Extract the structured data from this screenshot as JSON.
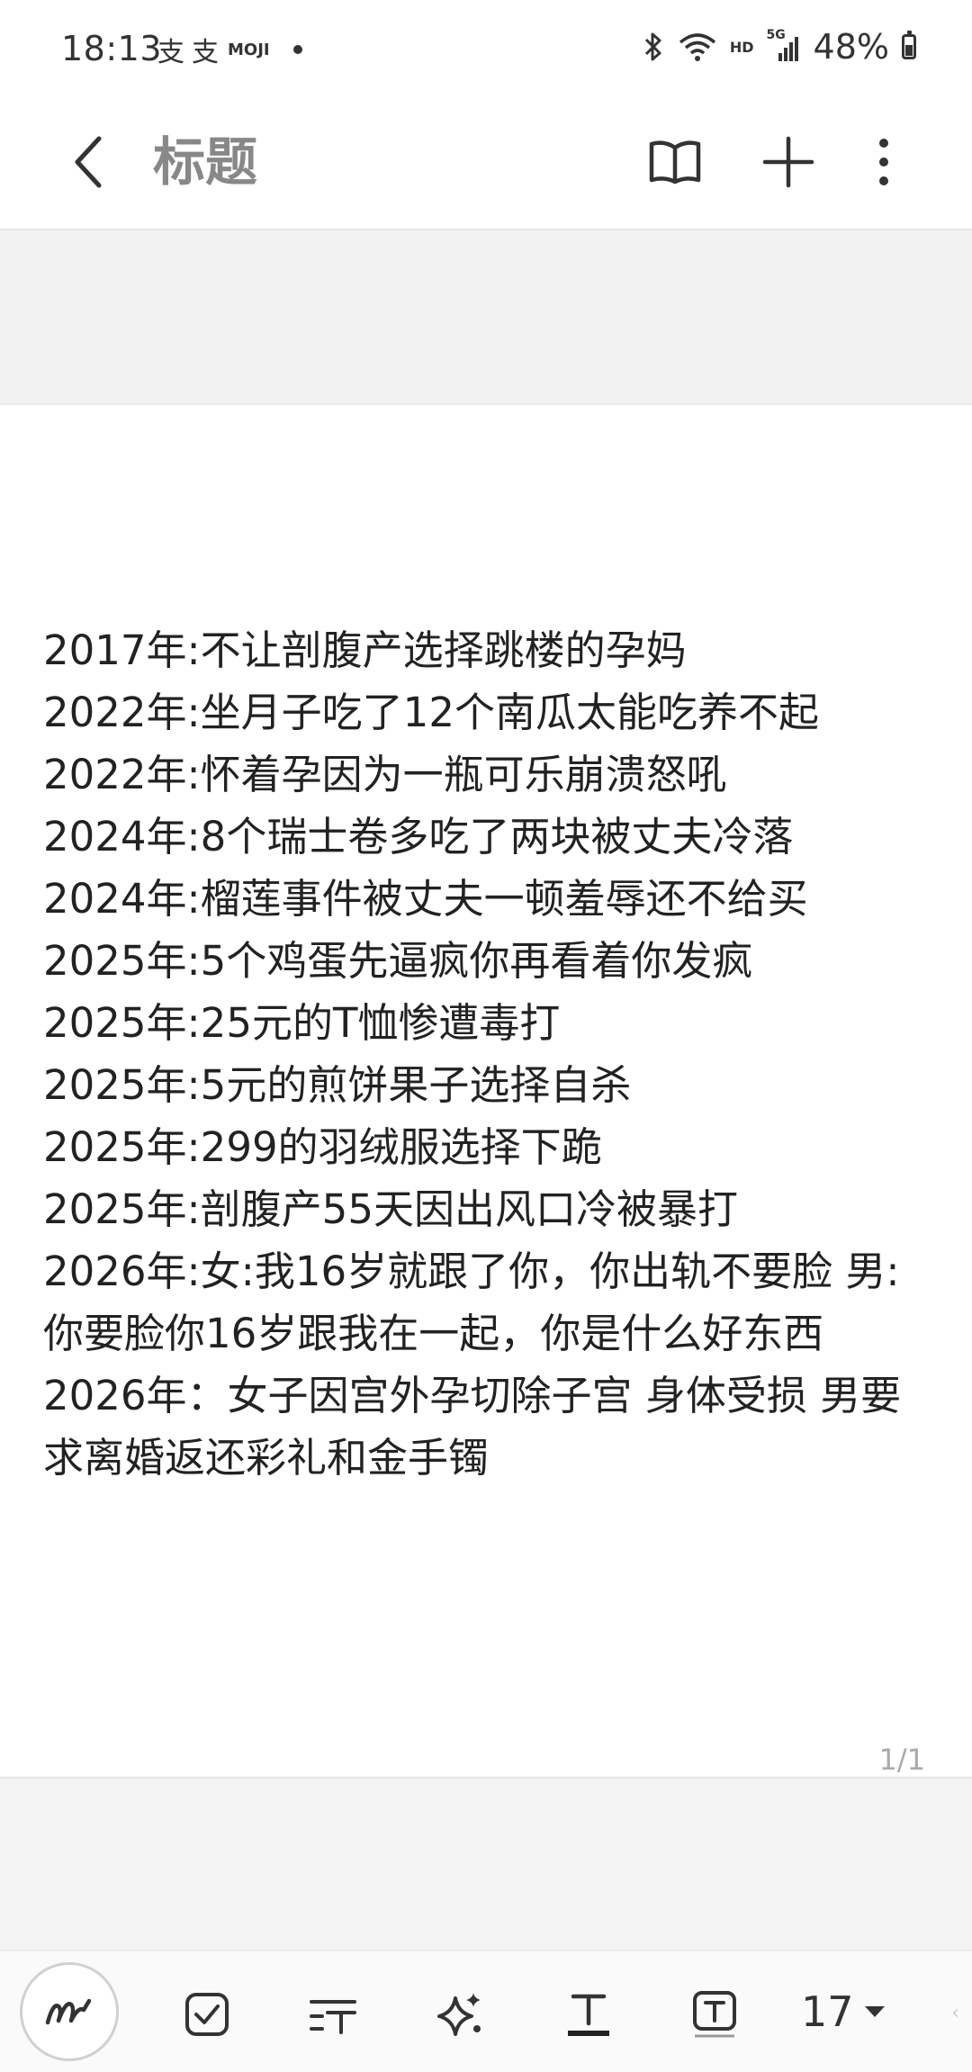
{
  "status_bar": {
    "time": "18:13",
    "app_glyph_1": "支",
    "app_glyph_2": "支",
    "moji": "MOJI",
    "hd": "HD",
    "network": "5G",
    "battery_percent": "48%"
  },
  "header": {
    "title": "标题"
  },
  "note": {
    "lines": [
      "2017年:不让剖腹产选择跳楼的孕妈",
      "2022年:坐月子吃了12个南瓜太能吃养不起",
      "2022年:怀着孕因为一瓶可乐崩溃怒吼",
      "2024年:8个瑞士卷多吃了两块被丈夫冷落",
      "2024年:榴莲事件被丈夫一顿羞辱还不给买",
      "2025年:5个鸡蛋先逼疯你再看着你发疯",
      "2025年:25元的T恤惨遭毒打",
      "2025年:5元的煎饼果子选择自杀",
      "2025年:299的羽绒服选择下跪",
      "2025年:剖腹产55天因出风口冷被暴打",
      "2026年:女:我16岁就跟了你，你出轨不要脸 男:你要脸你16岁跟我在一起，你是什么好东西",
      "2026年：女子因宫外孕切除子宫 身体受损 男要求离婚返还彩礼和金手镯"
    ],
    "page_counter": "1/1"
  },
  "toolbar": {
    "font_size": "17"
  }
}
